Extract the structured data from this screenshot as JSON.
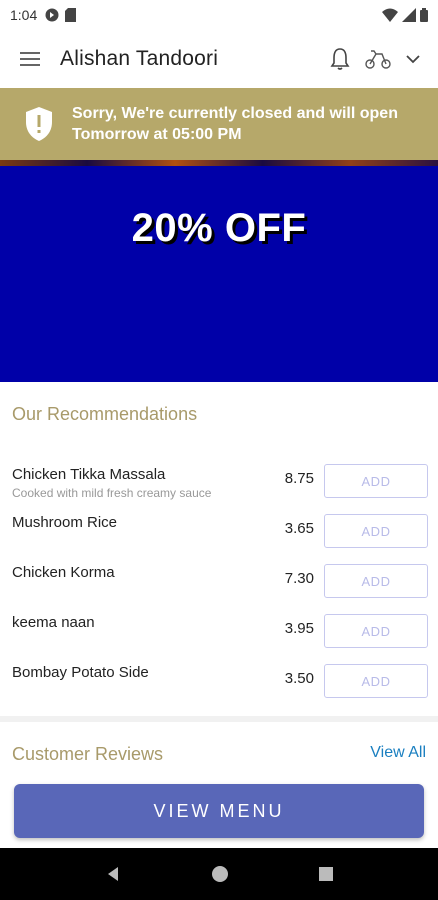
{
  "status_bar": {
    "time": "1:04"
  },
  "app_bar": {
    "title": "Alishan Tandoori"
  },
  "banner": {
    "message_line1": "Sorry, We're currently closed and will open",
    "message_line2": "Tomorrow at 05:00 PM"
  },
  "promo": {
    "text": "20% OFF"
  },
  "recommendations": {
    "title": "Our Recommendations",
    "add_label": "ADD",
    "items": [
      {
        "name": "Chicken Tikka Massala",
        "description": "Cooked with mild fresh creamy sauce",
        "price": "8.75"
      },
      {
        "name": "Mushroom Rice",
        "description": "",
        "price": "3.65"
      },
      {
        "name": "Chicken Korma",
        "description": "",
        "price": "7.30"
      },
      {
        "name": "keema naan",
        "description": "",
        "price": "3.95"
      },
      {
        "name": "Bombay Potato Side",
        "description": "",
        "price": "3.50"
      }
    ]
  },
  "reviews": {
    "title": "Customer Reviews",
    "view_all": "View All"
  },
  "actions": {
    "view_menu": "VIEW MENU"
  },
  "colors": {
    "banner": "#b6a86a",
    "promo_bg": "#0000a8",
    "accent_gold": "#a89a6a",
    "button": "#5967b8",
    "link": "#1a7fc0"
  },
  "icons": [
    "hamburger-icon",
    "bell-icon",
    "scooter-icon",
    "chevron-down-icon",
    "shield-alert-icon",
    "back-icon",
    "home-icon",
    "recents-icon"
  ]
}
